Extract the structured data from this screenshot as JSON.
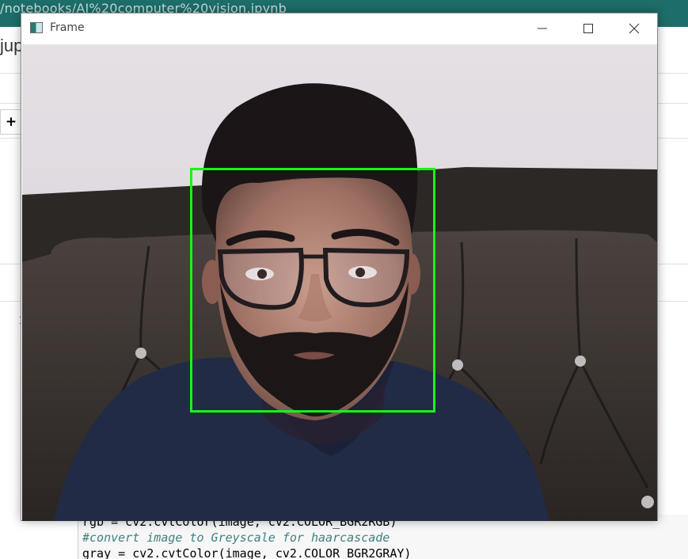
{
  "browser": {
    "url_fragment": "/notebooks/AI%20computer%20vision.ipynb"
  },
  "notebook": {
    "logo_fragment": "jup",
    "add_cell_button": "+",
    "cell_prompt_fragment": "I",
    "code_lines": [
      "rgb = cv2.cvtColor(image, cv2.COLOR_BGR2RGB)",
      "#convert image to Greyscale for haarcascade",
      "gray = cv2.cvtColor(image, cv2.COLOR_BGR2GRAY)"
    ]
  },
  "frame_window": {
    "title": "Frame",
    "icon": "window-app-icon",
    "controls": [
      "minimize-icon",
      "maximize-icon",
      "close-icon"
    ],
    "detection_color": "#1af21a"
  },
  "colors": {
    "browser_bar": "#1d6e6a",
    "comment": "#408080"
  }
}
